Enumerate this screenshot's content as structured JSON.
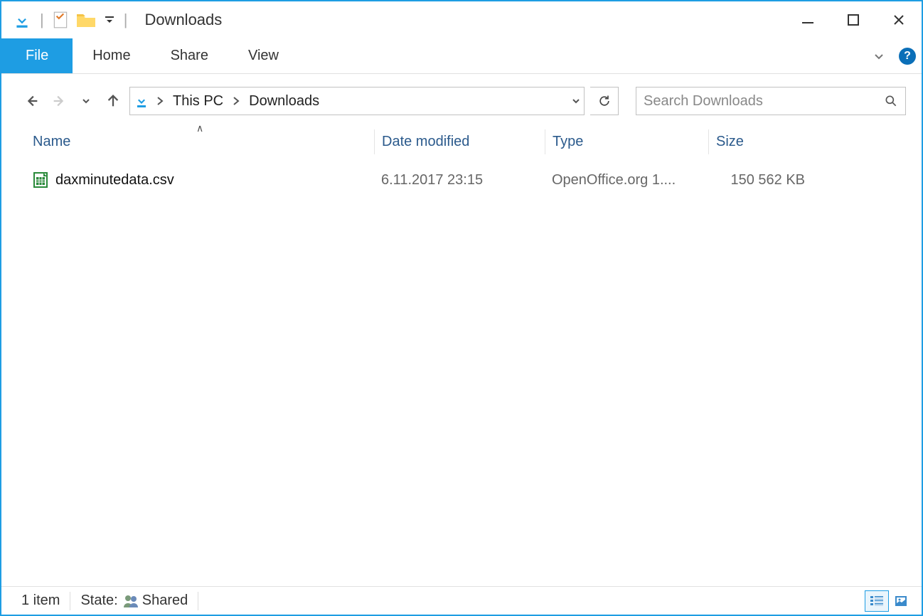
{
  "window": {
    "title": "Downloads"
  },
  "ribbon": {
    "file": "File",
    "tabs": [
      "Home",
      "Share",
      "View"
    ]
  },
  "address": {
    "crumbs": [
      "This PC",
      "Downloads"
    ]
  },
  "search": {
    "placeholder": "Search Downloads"
  },
  "columns": {
    "name": "Name",
    "date": "Date modified",
    "type": "Type",
    "size": "Size"
  },
  "files": [
    {
      "name": "daxminutedata.csv",
      "date": "6.11.2017 23:15",
      "type": "OpenOffice.org 1....",
      "size": "150 562 KB"
    }
  ],
  "status": {
    "items": "1 item",
    "state_label": "State:",
    "state_value": "Shared"
  }
}
